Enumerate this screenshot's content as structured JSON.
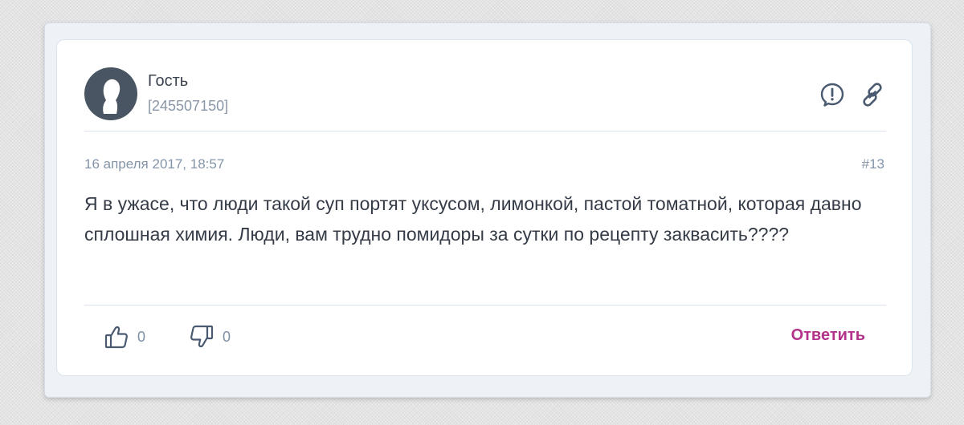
{
  "comment": {
    "author": {
      "name": "Гость",
      "id": "[245507150]"
    },
    "date": "16 апреля 2017, 18:57",
    "number": "#13",
    "text": "Я в ужасе, что люди такой суп портят уксусом, лимонкой, пастой томатной, которая давно сплошная химия. Люди, вам трудно помидоры за сутки по рецепту заквасить????",
    "likes": "0",
    "dislikes": "0",
    "reply_label": "Ответить",
    "icons": {
      "report": "exclamation-circle-icon",
      "link": "chain-link-icon",
      "like": "thumbs-up-icon",
      "dislike": "thumbs-down-icon",
      "avatar": "user-silhouette-icon"
    }
  },
  "colors": {
    "accent": "#b3338a",
    "icon": "#4a5a70",
    "meta": "#8494a9",
    "text": "#353c47",
    "avatar_bg": "#4a5563"
  }
}
